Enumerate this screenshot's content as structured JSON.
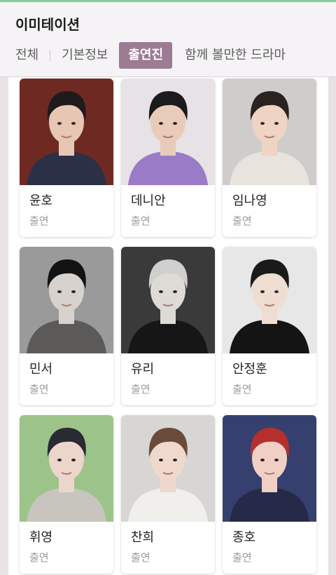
{
  "header": {
    "title": "이미테이션",
    "tabs": [
      {
        "label": "전체"
      },
      {
        "label": "기본정보"
      },
      {
        "label": "출연진",
        "active": true
      },
      {
        "label": "함께 볼만한 드라마"
      }
    ]
  },
  "cast": [
    {
      "name": "윤호",
      "role": "출연",
      "bg": "#6e2a22",
      "skin": "#e8c6b4",
      "hair": "#1f1a1c",
      "shirt": "#2c3046"
    },
    {
      "name": "데니안",
      "role": "출연",
      "bg": "#e6e2e6",
      "skin": "#e9cbb9",
      "hair": "#1b1a1c",
      "shirt": "#9a7bc8"
    },
    {
      "name": "임나영",
      "role": "출연",
      "bg": "#cfcdcb",
      "skin": "#efd4c3",
      "hair": "#2a221f",
      "shirt": "#e9e3de"
    },
    {
      "name": "민서",
      "role": "출연",
      "bg": "#9a9a9a",
      "skin": "#d7d2ce",
      "hair": "#121212",
      "shirt": "#5b5a58"
    },
    {
      "name": "유리",
      "role": "출연",
      "bg": "#3a3a3a",
      "skin": "#dedad6",
      "hair": "#cfcfcf",
      "shirt": "#161616"
    },
    {
      "name": "안정훈",
      "role": "출연",
      "bg": "#e7e7e7",
      "skin": "#eeddd0",
      "hair": "#1a1a1a",
      "shirt": "#141414"
    },
    {
      "name": "휘영",
      "role": "출연",
      "bg": "#9cc48a",
      "skin": "#ecd6cc",
      "hair": "#2a2a32",
      "shirt": "#c8c4be"
    },
    {
      "name": "찬희",
      "role": "출연",
      "bg": "#d7d6d4",
      "skin": "#efd9cc",
      "hair": "#6b4c3a",
      "shirt": "#f1efec"
    },
    {
      "name": "종호",
      "role": "출연",
      "bg": "#35406e",
      "skin": "#f0d0c4",
      "hair": "#b5302c",
      "shirt": "#262a48"
    }
  ]
}
